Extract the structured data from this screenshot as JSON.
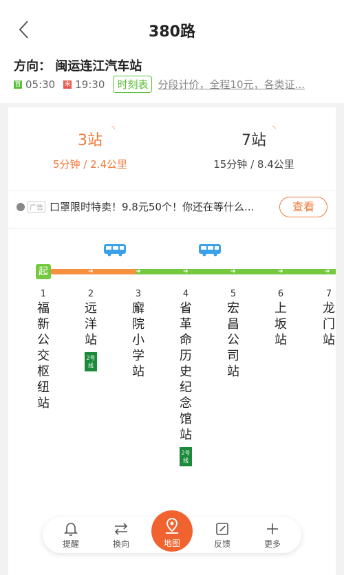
{
  "header": {
    "title": "380路",
    "direction": "方向：  闽运连江汽车站",
    "first_tag": "首",
    "first_time": "05:30",
    "last_tag": "末",
    "last_time": "19:30",
    "timetable_label": "时刻表",
    "fare_text": "分段计价，全程10元，各类证..."
  },
  "arrivals": [
    {
      "stops": "3站",
      "detail": "5分钟 / 2.4公里"
    },
    {
      "stops": "7站",
      "detail": "15分钟 / 8.4公里"
    }
  ],
  "ad": {
    "tag": "广告",
    "text": "口罩限时特卖！9.8元50个！你还在等什么...",
    "button": "查看"
  },
  "route": {
    "start_badge": "起",
    "stops": [
      {
        "num": "1",
        "name": "福新公交枢纽站",
        "metro": ""
      },
      {
        "num": "2",
        "name": "远洋站",
        "metro": "2号线"
      },
      {
        "num": "3",
        "name": "廨院小学站",
        "metro": ""
      },
      {
        "num": "4",
        "name": "省革命历史纪念馆站",
        "metro": "2号线"
      },
      {
        "num": "5",
        "name": "宏昌公司站",
        "metro": ""
      },
      {
        "num": "6",
        "name": "上坂站",
        "metro": ""
      },
      {
        "num": "7",
        "name": "龙门站",
        "metro": ""
      }
    ]
  },
  "nav": {
    "remind": "提醒",
    "switch": "换向",
    "map": "地图",
    "feedback": "反馈",
    "more": "更多"
  },
  "icons": {
    "back": "chevron-left-icon",
    "bus": "bus-icon",
    "remind": "bell-icon",
    "switch": "swap-icon",
    "map": "map-pin-icon",
    "feedback": "edit-icon",
    "more": "plus-icon"
  },
  "colors": {
    "accent": "#f0632f",
    "green": "#74c93f",
    "orange": "#f5913e",
    "bus_blue": "#3aa0e8",
    "metro_green": "#1b8a3a"
  }
}
